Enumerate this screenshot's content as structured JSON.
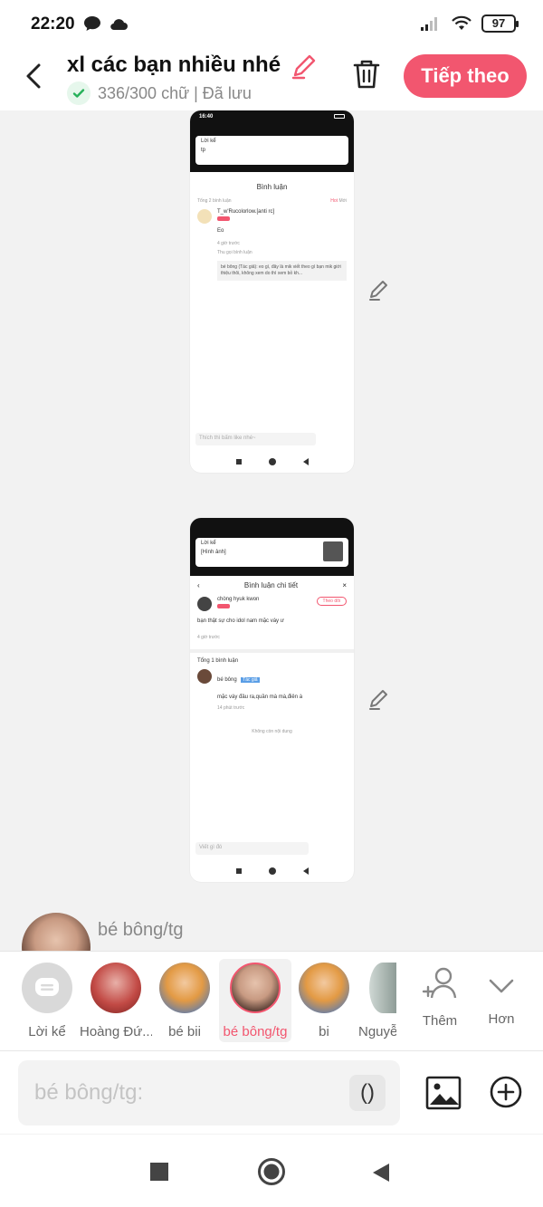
{
  "status_bar": {
    "time": "22:20",
    "battery": "97"
  },
  "header": {
    "title": "xl các bạn nhiều nhé",
    "subtitle": "336/300 chữ | Đã lưu",
    "next_label": "Tiếp theo"
  },
  "thumb1": {
    "time": "16:40",
    "card_title": "Lời kể",
    "card_text": "tp",
    "section_title": "Bình luận",
    "count": "Tổng 2 bình luận",
    "sort_hot": "Hot",
    "sort_new": "Mới",
    "user": "T_w'Rucolorlow.[anti rc]",
    "comment": "Eo",
    "time_ago": "4 giờ trước",
    "view_reply": "Thu gọi bình luận",
    "reply_text": "bé bông (Tác giả): eo gì, đây là mik viết theo gì bạn mik giới thiệu thôi, không xem do thì xem bỏ kh...",
    "input_ph": "Thích thì bấm like nhé~"
  },
  "thumb2": {
    "card_title": "Lời kể",
    "card_text": "[Hình ảnh]",
    "section_title": "Bình luận chi tiết",
    "user": "chòng hyuk kwon",
    "follow": "Theo dõi",
    "comment": "bạn thật sự cho idol nam mặc váy ư",
    "time_ago": "4 giờ trước",
    "count": "Tổng 1 bình luận",
    "user2": "bé bông",
    "badge": "Tác giả",
    "comment2": "mặc váy đâu ra,quần mà mà,điên à",
    "time2": "14 phút trước",
    "no_more": "Không còn nội dung",
    "input_ph": "Viết gì đó"
  },
  "speaker": {
    "name": "bé bông/tg"
  },
  "characters": [
    {
      "label": "Lời kể"
    },
    {
      "label": "Hoàng Đứ..."
    },
    {
      "label": "bé bii"
    },
    {
      "label": "bé bông/tg"
    },
    {
      "label": "bi"
    },
    {
      "label": "Nguyễ"
    },
    {
      "label": "Thêm"
    },
    {
      "label": "Hơn"
    }
  ],
  "input": {
    "placeholder": "bé bông/tg:",
    "paren": "()"
  }
}
